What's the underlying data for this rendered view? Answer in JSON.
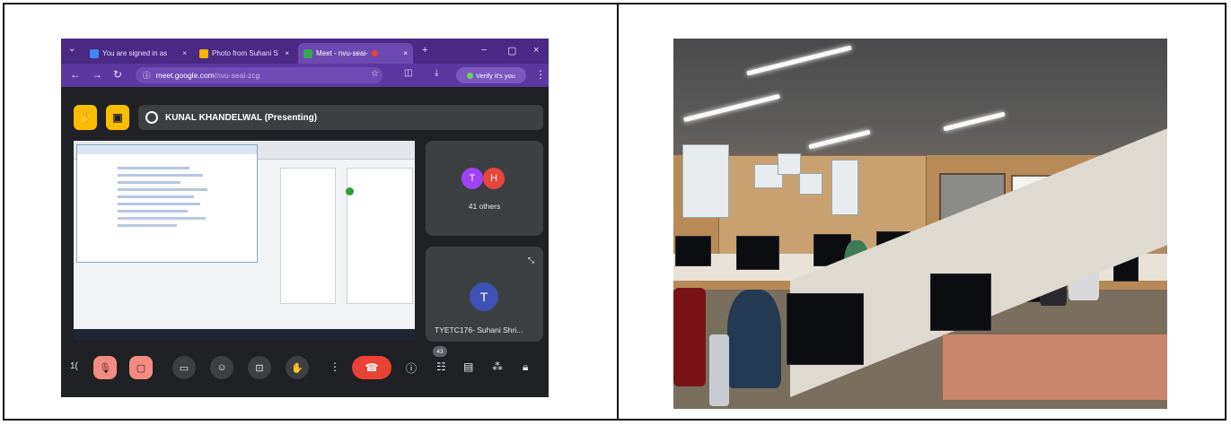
{
  "meet": {
    "tabs": [
      {
        "label": "You are signed in as",
        "close": "×",
        "favicon_color": "#4285f4"
      },
      {
        "label": "Photo from Suhani S",
        "close": "×",
        "favicon_color": "#f4b400"
      },
      {
        "label": "Meet - nvu-seai-",
        "close": "×",
        "favicon_color": "#34a853"
      }
    ],
    "new_tab": "+",
    "window_controls": {
      "minimize": "−",
      "restore": "▢",
      "close": "×"
    },
    "address": {
      "domain": "meet.google.com",
      "path": "/nvu-seai-zcg"
    },
    "verify_label": "Verify it's you",
    "presenter_label": "KUNAL KHANDELWAL (Presenting)",
    "participants": {
      "group_initials": [
        "T",
        "H"
      ],
      "group_colors": [
        "#a142f4",
        "#e8453c"
      ],
      "others_label": "41 others",
      "single_initial": "T",
      "single_color": "#3f51b5",
      "single_name": "TYETC176- Suhani Shri..."
    },
    "controls": {
      "left_label": "1(",
      "people_count": "43"
    },
    "colors": {
      "tabbar": "#4b2a86",
      "addrbar": "#5b37a0",
      "background": "#202124",
      "accent_yellow": "#fbbc04",
      "end_call": "#ea4335"
    }
  }
}
